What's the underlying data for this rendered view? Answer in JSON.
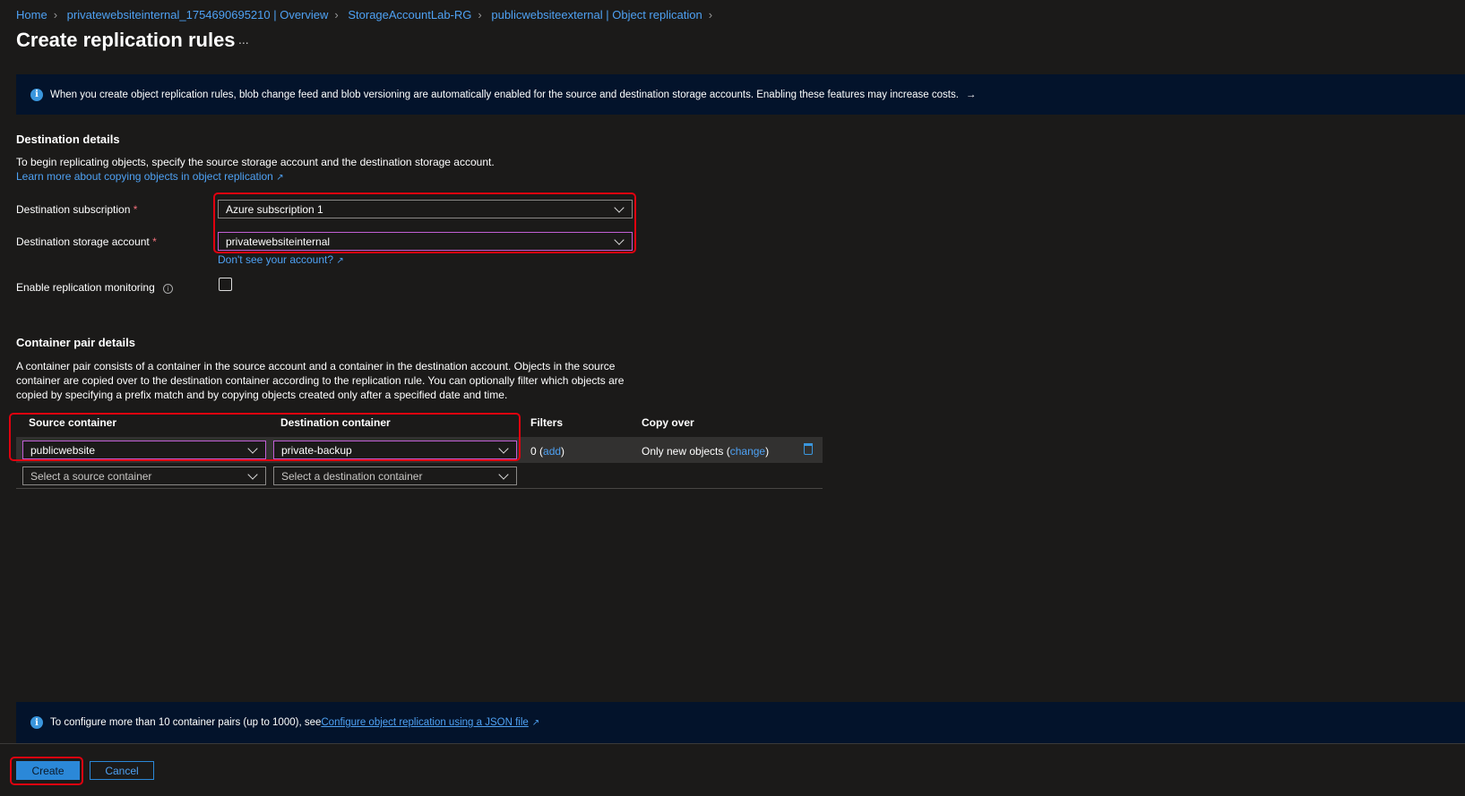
{
  "breadcrumb": [
    "Home",
    "privatewebsiteinternal_1754690695210 | Overview",
    "StorageAccountLab-RG",
    "publicwebsiteexternal | Object replication"
  ],
  "title": "Create replication rules",
  "more": "...",
  "top_info": "When you create object replication rules, blob change feed and blob versioning are automatically enabled for the source and destination storage accounts. Enabling these features may increase costs.",
  "top_info_arrow": "→",
  "destination": {
    "heading": "Destination details",
    "desc": "To begin replicating objects, specify the source storage account and the destination storage account.",
    "learn_link": "Learn more about copying objects in object replication",
    "subscription_label": "Destination subscription",
    "subscription_value": "Azure subscription 1",
    "account_label": "Destination storage account",
    "account_value": "privatewebsiteinternal",
    "dont_see": "Don't see your account?",
    "monitoring_label": "Enable replication monitoring",
    "required": "*"
  },
  "container": {
    "heading": "Container pair details",
    "desc": "A container pair consists of a container in the source account and a container in the destination account. Objects in the source container are copied over to the destination container according to the replication rule. You can optionally filter which objects are copied by specifying a prefix match and by copying objects created only after a specified date and time.",
    "columns": [
      "Source container",
      "Destination container",
      "Filters",
      "Copy over"
    ],
    "row": {
      "source": "publicwebsite",
      "destination": "private-backup",
      "filters_count": "0 (",
      "filters_add": "add",
      "filters_close": ")",
      "copy": "Only new objects (",
      "copy_change": "change",
      "copy_close": ")"
    },
    "new_row": {
      "source_placeholder": "Select a source container",
      "destination_placeholder": "Select a destination container"
    }
  },
  "bottom_info": {
    "text": "To configure more than 10 container pairs (up to 1000), see ",
    "link": "Configure object replication using a JSON file"
  },
  "buttons": {
    "create": "Create",
    "cancel": "Cancel"
  }
}
